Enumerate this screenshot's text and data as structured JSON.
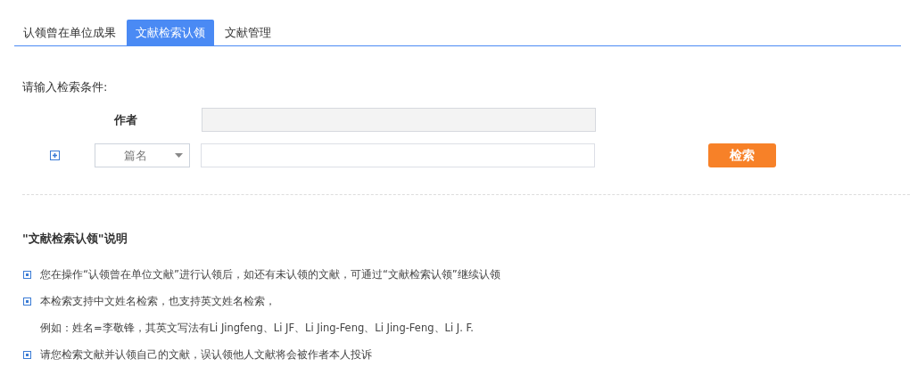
{
  "tabs": [
    {
      "label": "认领曾在单位成果",
      "selected": false
    },
    {
      "label": "文献检索认领",
      "selected": true
    },
    {
      "label": "文献管理",
      "selected": false
    }
  ],
  "search": {
    "prompt": "请输入检索条件:",
    "author": {
      "label": "作者",
      "disabled": true
    },
    "field_select": {
      "value": "篇名"
    },
    "button": "检索"
  },
  "notes": {
    "title": "\"文献检索认领\"说明",
    "items": [
      {
        "kind": "bullet",
        "text": "您在操作“认领曾在单位文献”进行认领后，如还有未认领的文献，可通过“文献检索认领”继续认领"
      },
      {
        "kind": "bullet",
        "text": "本检索支持中文姓名检索，也支持英文姓名检索，"
      },
      {
        "kind": "continuation",
        "text": "例如：姓名=李敬锋，其英文写法有Li Jingfeng、Li JF、Li Jing-Feng、Li Jing-Feng、Li J. F."
      },
      {
        "kind": "bullet",
        "text": "请您检索文献并认领自己的文献，误认领他人文献将会被作者本人投诉"
      }
    ]
  }
}
